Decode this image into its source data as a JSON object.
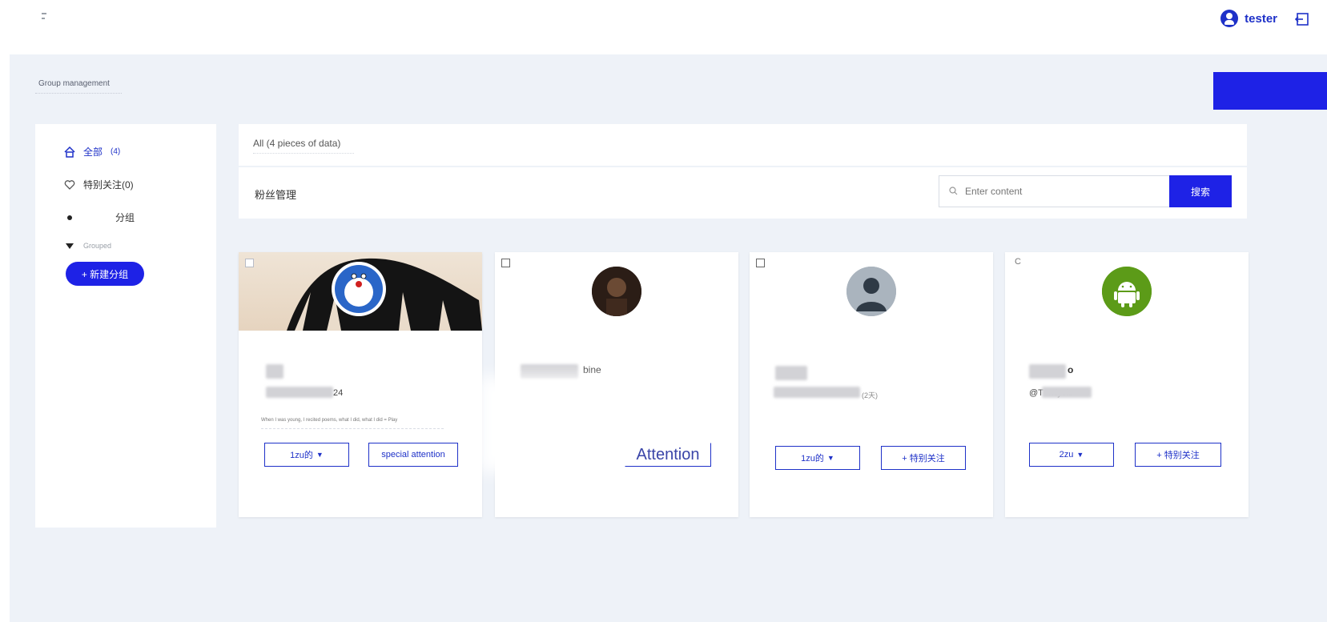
{
  "header": {
    "username": "tester",
    "menu_icon": "menu-icon",
    "user_icon": "user-icon",
    "logout_icon": "logout-icon"
  },
  "page": {
    "title": "Group management",
    "primary_button_label": ""
  },
  "sidebar": {
    "items": [
      {
        "label": "全部",
        "count": "(4)",
        "icon": "home-icon"
      },
      {
        "label": "特别关注(0)",
        "icon": "heart-icon"
      },
      {
        "label": "分组",
        "icon": "dot-icon"
      }
    ],
    "grouped_label": "Grouped",
    "grouped_icon": "caret-down-icon",
    "new_group_label": "+ 新建分组"
  },
  "panel": {
    "tab_label": "All (4 pieces of data)",
    "section_title": "粉丝管理",
    "search_placeholder": "Enter content",
    "search_button": "搜索"
  },
  "cards": [
    {
      "name": "",
      "handle": "24",
      "bio": "When I was young, I recited poems, what I did, what I did = Play",
      "group_button": "1zu的",
      "follow_button": "special attention"
    },
    {
      "name": "bine",
      "handle": "",
      "group_button": "",
      "follow_button": "Attention"
    },
    {
      "name": "",
      "handle": "(2天)",
      "group_button": "1zu的",
      "follow_button": "+ 特别关注"
    },
    {
      "name": "o",
      "handle": "@T           nalysis",
      "group_button": "2zu",
      "follow_button": "+ 特别关注"
    }
  ],
  "colors": {
    "accent": "#1e22e6",
    "link": "#1e31c8",
    "background": "#eef2f8"
  }
}
